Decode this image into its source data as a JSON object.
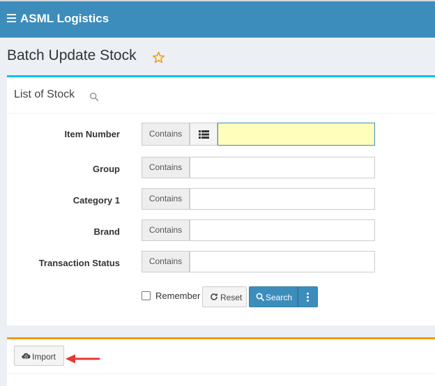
{
  "app": {
    "brand": "ASML Logistics"
  },
  "page": {
    "title": "Batch Update Stock"
  },
  "stock_box": {
    "title": "List of Stock",
    "filters": [
      {
        "label": "Item Number",
        "operator": "Contains",
        "value": ""
      },
      {
        "label": "Group",
        "operator": "Contains",
        "value": ""
      },
      {
        "label": "Category 1",
        "operator": "Contains",
        "value": ""
      },
      {
        "label": "Brand",
        "operator": "Contains",
        "value": ""
      },
      {
        "label": "Transaction Status",
        "operator": "Contains",
        "value": ""
      }
    ],
    "remember_label": "Remember",
    "remember_checked": false,
    "reset_label": "Reset",
    "search_label": "Search"
  },
  "import_box": {
    "import_label": "Import"
  },
  "colors": {
    "navbar": "#3c8dbc",
    "stock_box_accent": "#00c0ef",
    "import_box_accent": "#f39c12",
    "highlight_field": "#ffffbb",
    "annotation_arrow": "#e53935"
  },
  "icons": {
    "menu": "hamburger-icon",
    "favorite": "star-outline-icon",
    "title_search": "search-icon",
    "list_picker": "list-icon",
    "reset": "refresh-icon",
    "search": "search-icon",
    "more": "vertical-ellipsis-icon",
    "import": "cloud-upload-icon"
  }
}
